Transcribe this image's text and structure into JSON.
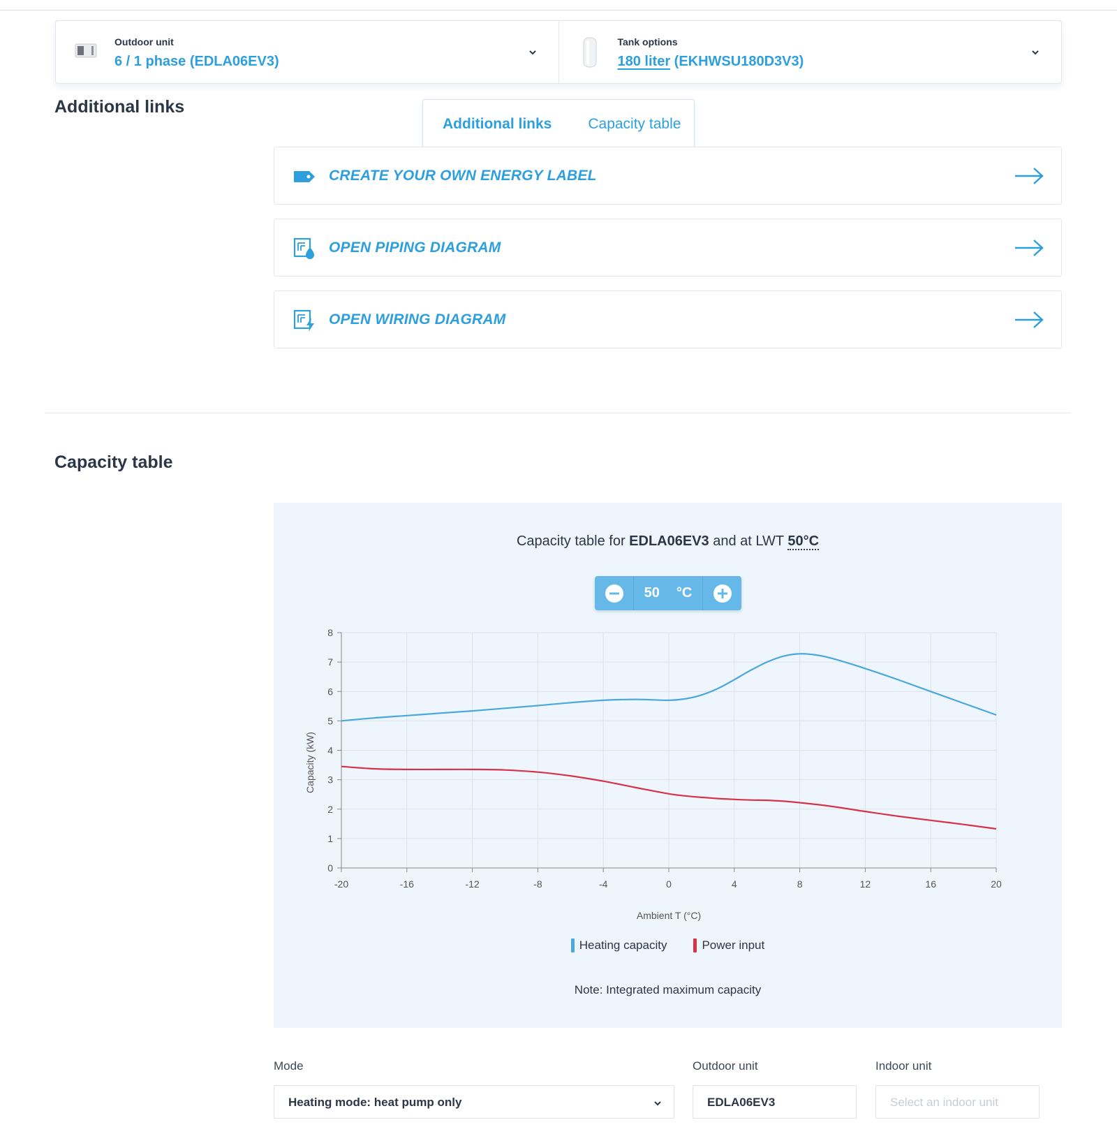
{
  "selector": {
    "outdoor_caption": "Outdoor unit",
    "outdoor_value": "6 / 1 phase (EDLA06EV3)",
    "tank_caption": "Tank options",
    "tank_value_main": "180 liter",
    "tank_value_code": " (EKHWSU180D3V3)"
  },
  "tabs": [
    "Additional links",
    "Capacity table"
  ],
  "additional_links": {
    "heading": "Additional links",
    "items": [
      {
        "label": "CREATE YOUR OWN ENERGY LABEL",
        "icon": "tag-icon"
      },
      {
        "label": "OPEN PIPING DIAGRAM",
        "icon": "piping-diagram-icon"
      },
      {
        "label": "OPEN WIRING DIAGRAM",
        "icon": "wiring-diagram-icon"
      }
    ]
  },
  "capacity": {
    "heading": "Capacity table",
    "title_prefix": "Capacity table for ",
    "title_model": "EDLA06EV3",
    "title_mid": " and at LWT ",
    "title_temp": "50°C",
    "stepper_value": "50",
    "stepper_unit": "°C",
    "note": "Note: Integrated maximum capacity"
  },
  "chart_data": {
    "type": "line",
    "xlabel": "Ambient T (°C)",
    "ylabel": "Capacity (kW)",
    "xlim": [
      -20,
      20
    ],
    "ylim": [
      0,
      8
    ],
    "xticks": [
      -20,
      -16,
      -12,
      -8,
      -4,
      0,
      4,
      8,
      12,
      16,
      20
    ],
    "yticks": [
      0,
      1,
      2,
      3,
      4,
      5,
      6,
      7,
      8
    ],
    "grid": true,
    "legend": "bottom",
    "x": [
      -20,
      -18,
      -16,
      -14,
      -12,
      -10,
      -8,
      -6,
      -4,
      -2,
      0,
      1,
      2,
      3,
      4,
      5,
      6,
      7,
      8,
      9,
      10,
      12,
      14,
      16,
      18,
      20
    ],
    "series": [
      {
        "name": "Heating capacity",
        "color": "#4aa8dc",
        "values": [
          5.0,
          5.1,
          5.18,
          5.26,
          5.34,
          5.43,
          5.52,
          5.62,
          5.7,
          5.73,
          5.7,
          5.75,
          5.88,
          6.1,
          6.4,
          6.72,
          7.0,
          7.2,
          7.28,
          7.24,
          7.12,
          6.78,
          6.4,
          6.0,
          5.6,
          5.2
        ]
      },
      {
        "name": "Power input",
        "color": "#d6324a",
        "values": [
          3.45,
          3.37,
          3.35,
          3.35,
          3.35,
          3.33,
          3.26,
          3.13,
          2.95,
          2.73,
          2.52,
          2.45,
          2.4,
          2.36,
          2.33,
          2.31,
          2.3,
          2.27,
          2.22,
          2.16,
          2.09,
          1.92,
          1.76,
          1.62,
          1.48,
          1.33
        ]
      }
    ]
  },
  "form": {
    "mode_label": "Mode",
    "mode_value": "Heating mode: heat pump only",
    "outdoor_label": "Outdoor unit",
    "outdoor_value": "EDLA06EV3",
    "indoor_label": "Indoor unit",
    "indoor_placeholder": "Select an indoor unit"
  },
  "colors": {
    "accent": "#2d9fdd",
    "stepper": "#66b8e9",
    "panel": "#eef5fc"
  }
}
